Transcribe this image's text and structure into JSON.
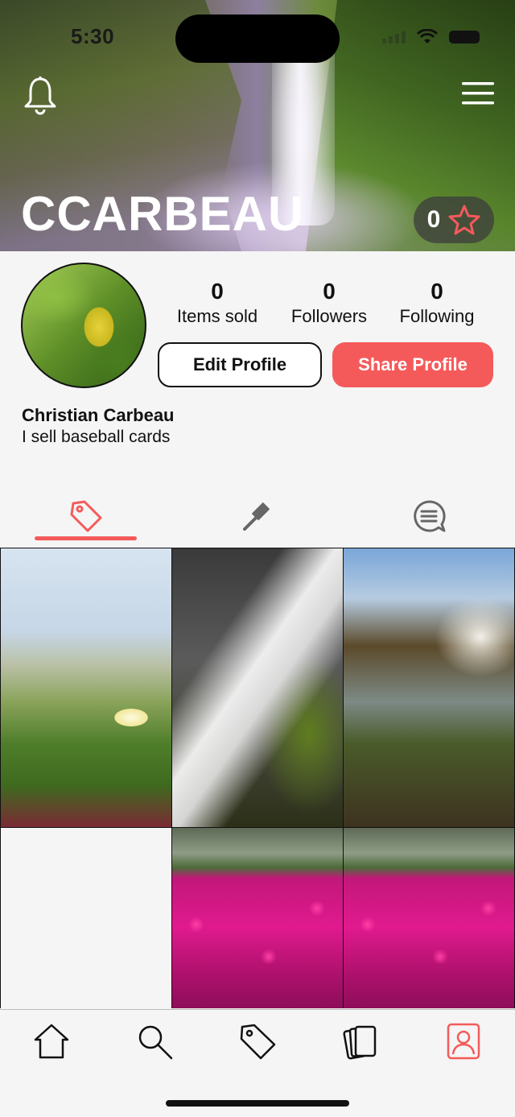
{
  "status_bar": {
    "time": "5:30"
  },
  "header": {
    "username": "CCARBEAU",
    "rating": "0"
  },
  "profile": {
    "stats": [
      {
        "value": "0",
        "label": "Items sold"
      },
      {
        "value": "0",
        "label": "Followers"
      },
      {
        "value": "0",
        "label": "Following"
      }
    ],
    "edit_label": "Edit Profile",
    "share_label": "Share Profile",
    "full_name": "Christian Carbeau",
    "bio": "I sell baseball cards"
  },
  "tabs": [
    {
      "icon": "price-tag-icon",
      "active": true
    },
    {
      "icon": "auction-gavel-icon",
      "active": false
    },
    {
      "icon": "chat-bubble-icon",
      "active": false
    }
  ],
  "grid": [
    {
      "description_icon": "photo",
      "empty": false
    },
    {
      "description_icon": "photo",
      "empty": false
    },
    {
      "description_icon": "photo",
      "empty": false
    },
    {
      "description_icon": "photo",
      "empty": true
    },
    {
      "description_icon": "photo",
      "empty": false
    },
    {
      "description_icon": "photo",
      "empty": false
    }
  ],
  "bottom_nav": [
    {
      "icon": "home-icon",
      "active": false
    },
    {
      "icon": "search-icon",
      "active": false
    },
    {
      "icon": "price-tag-icon",
      "active": false
    },
    {
      "icon": "cards-icon",
      "active": false
    },
    {
      "icon": "profile-icon",
      "active": true
    }
  ],
  "colors": {
    "accent": "#f55a5a",
    "background": "#f5f5f5",
    "text": "#111111"
  }
}
